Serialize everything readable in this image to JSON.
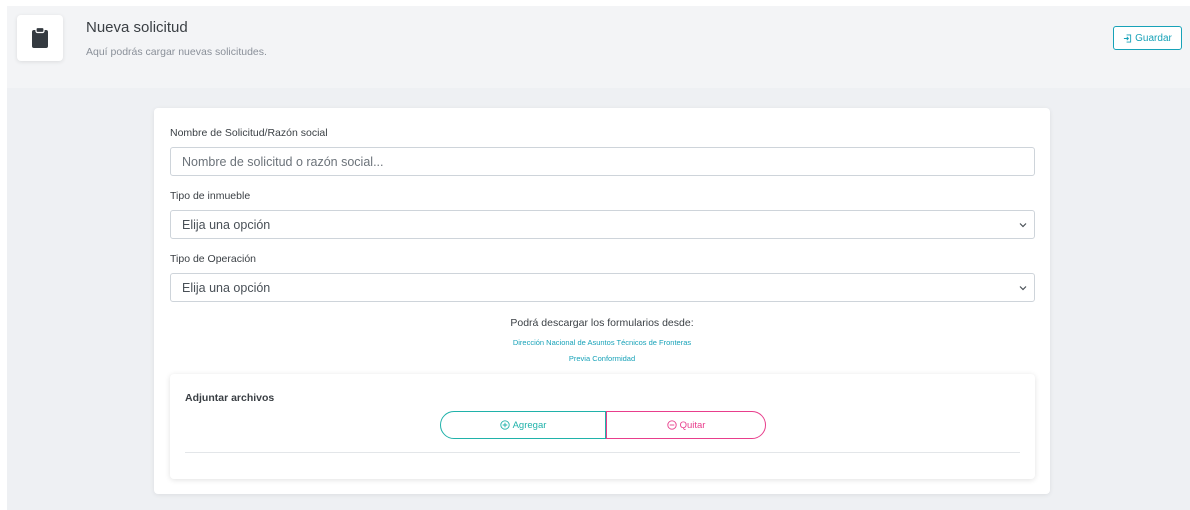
{
  "header": {
    "title": "Nueva solicitud",
    "subtitle": "Aquí podrás cargar nuevas solicitudes.",
    "icon": "clipboard-icon",
    "save_label": "Guardar",
    "save_icon": "sign-in-icon"
  },
  "form": {
    "name": {
      "label": "Nombre de Solicitud/Razón social",
      "placeholder": "Nombre de solicitud o razón social..."
    },
    "property_type": {
      "label": "Tipo de inmueble",
      "selected": "Elija una opción"
    },
    "operation_type": {
      "label": "Tipo de Operación",
      "selected": "Elija una opción"
    }
  },
  "downloads": {
    "intro": "Podrá descargar los formularios desde:",
    "links": [
      "Dirección Nacional de Asuntos Técnicos de Fronteras",
      "Previa Conformidad"
    ]
  },
  "attachments": {
    "title": "Adjuntar archivos",
    "add_label": "Agregar",
    "remove_label": "Quitar"
  },
  "colors": {
    "accent": "#17a2b8",
    "add": "#20b2aa",
    "remove": "#e83e8c",
    "background": "#eef0f3"
  }
}
